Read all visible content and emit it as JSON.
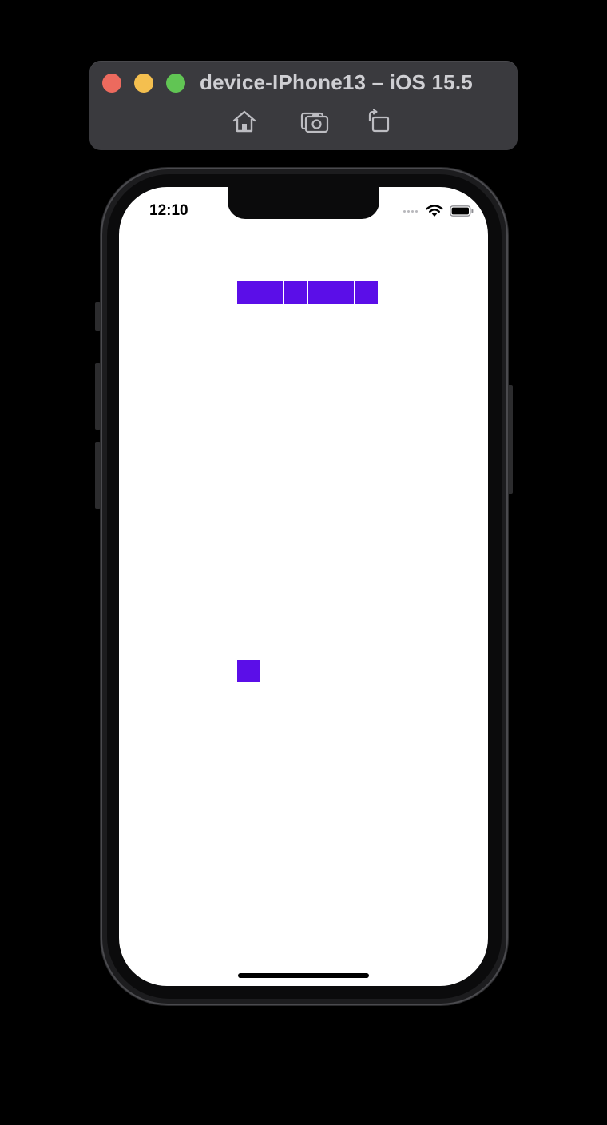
{
  "window": {
    "title": "device-IPhone13 – iOS 15.5",
    "traffic_lights": [
      "close",
      "minimize",
      "zoom"
    ],
    "toolbar": {
      "home_icon": "home-icon",
      "screenshot_icon": "camera-icon",
      "rotate_icon": "rotate-icon"
    }
  },
  "device": {
    "status_bar": {
      "time": "12:10",
      "wifi_icon": "wifi-icon",
      "battery_icon": "battery-icon"
    }
  },
  "game": {
    "block_color": "#5b0ee8",
    "paddle_segments": 6,
    "ball_count": 1
  },
  "colors": {
    "close": "#ec6a5e",
    "minimize": "#f4bf4f",
    "zoom": "#61c554",
    "toolbar_bg": "#3a3a3e",
    "accent": "#5b0ee8"
  }
}
